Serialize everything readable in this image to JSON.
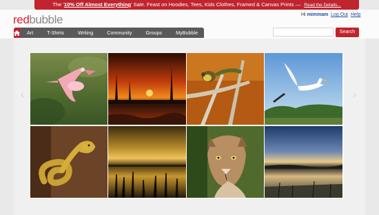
{
  "promo": {
    "prefix": "The '",
    "highlight": "10% Off Almost Everything",
    "suffix": "' Sale. Feast on Hoodies, Tees, Kids Clothes, Framed & Canvas Prints —",
    "read_more": "Read the Details..."
  },
  "brand": {
    "part1": "red",
    "part2": "bubble"
  },
  "user": {
    "greeting": "Hi",
    "username": "mimmam",
    "logout": "Log Out",
    "help": "Help"
  },
  "nav": {
    "home_icon": "home-icon",
    "items": [
      "Art",
      "T-Shirts",
      "Writing",
      "Community",
      "Groups",
      "MyBubble"
    ]
  },
  "search": {
    "button": "Search",
    "value": ""
  },
  "gallery": {
    "tiles": [
      {
        "subject": "roseate-spoonbill-in-flight"
      },
      {
        "subject": "orange-sunset-over-marsh"
      },
      {
        "subject": "warbler-on-branches"
      },
      {
        "subject": "white-egret-flying"
      },
      {
        "subject": "coiled-yellow-snake"
      },
      {
        "subject": "golden-sky-over-reeds"
      },
      {
        "subject": "florida-panther-portrait"
      },
      {
        "subject": "dusk-over-wetland"
      }
    ]
  },
  "colors": {
    "brand_red": "#c0242f",
    "nav_gray": "#5a5a5a",
    "link_blue": "#1f4fa3"
  }
}
